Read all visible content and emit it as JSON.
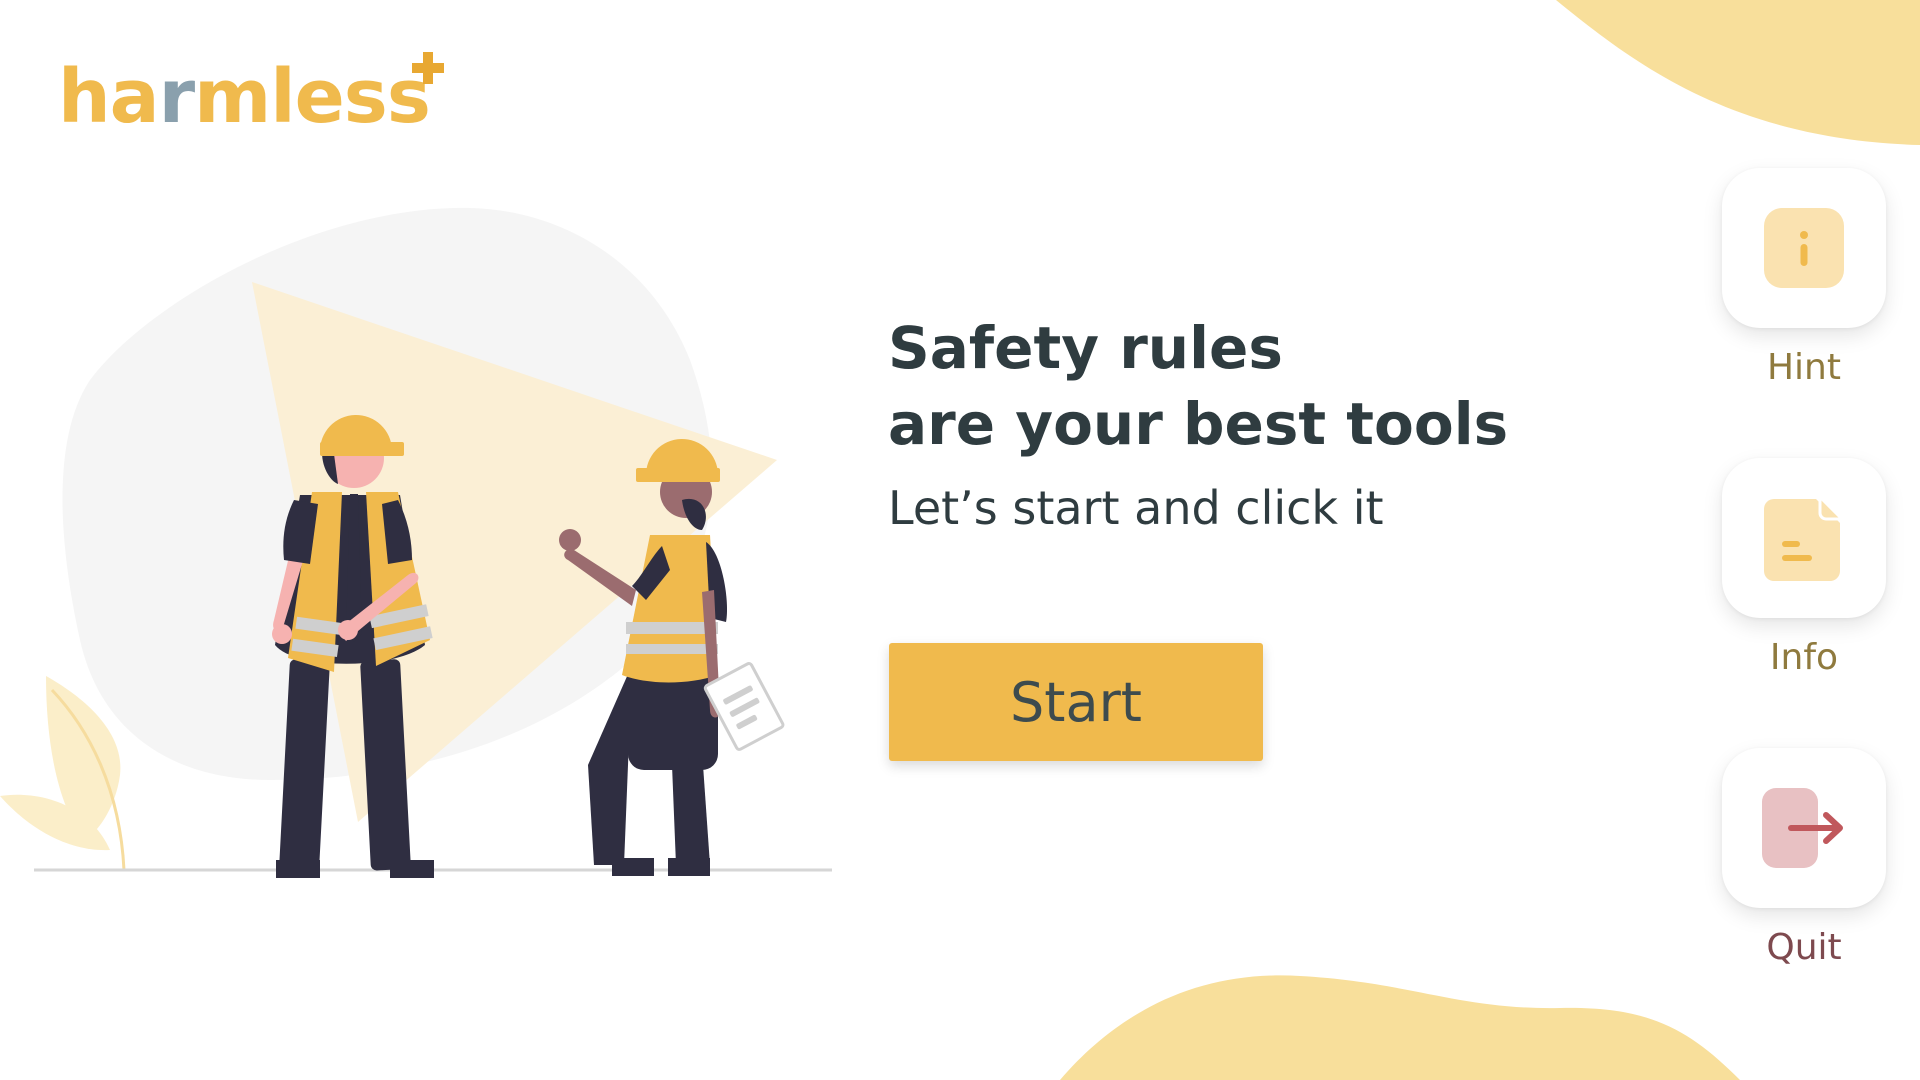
{
  "app": {
    "logo": {
      "parts": [
        "ha",
        "r",
        "mless"
      ],
      "accent_color": "#f0ba4d",
      "secondary_color": "#8aa0ad",
      "plus_color": "#e8a832"
    }
  },
  "main": {
    "headline_line1": "Safety rules",
    "headline_line2": "are your best tools",
    "subline": "Let’s start and click it",
    "start_label": "Start"
  },
  "side_menu": {
    "items": [
      {
        "label": "Hint",
        "icon": "info-icon"
      },
      {
        "label": "Info",
        "icon": "document-icon"
      },
      {
        "label": "Quit",
        "icon": "exit-icon"
      }
    ]
  },
  "colors": {
    "primary": "#f0ba4d",
    "blob": "#f8df9b",
    "text_dark": "#2f3c40",
    "quit_accent": "#c0585c"
  }
}
